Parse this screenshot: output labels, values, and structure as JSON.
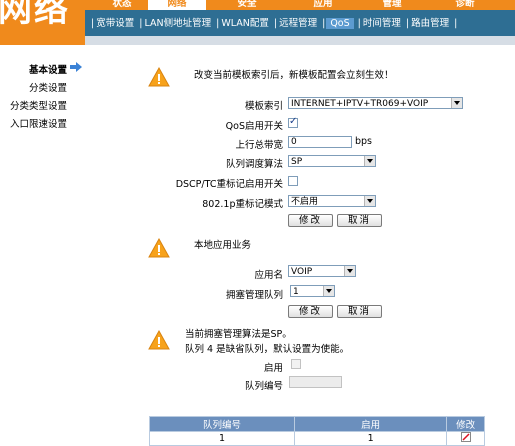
{
  "brand": {
    "text": "网络"
  },
  "main_tabs": [
    {
      "label": "状态"
    },
    {
      "label": "网络"
    },
    {
      "label": "安全"
    },
    {
      "label": "应用"
    },
    {
      "label": "管理"
    },
    {
      "label": "诊断"
    }
  ],
  "sub_nav": [
    {
      "label": "宽带设置"
    },
    {
      "label": "LAN侧地址管理"
    },
    {
      "label": "WLAN配置"
    },
    {
      "label": "远程管理"
    },
    {
      "label": "QoS"
    },
    {
      "label": "时间管理"
    },
    {
      "label": "路由管理"
    }
  ],
  "sidebar": {
    "items": [
      {
        "label": "基本设置"
      },
      {
        "label": "分类设置"
      },
      {
        "label": "分类类型设置"
      },
      {
        "label": "入口限速设置"
      }
    ]
  },
  "section1": {
    "warning": "改变当前模板索引后，新模板配置会立刻生效！",
    "template_label": "模板索引",
    "template_value": "INTERNET+IPTV+TR069+VOIP",
    "qos_enable_label": "QoS启用开关",
    "qos_enable_checked": true,
    "uplink_label": "上行总带宽",
    "uplink_value": "0",
    "uplink_unit": "bps",
    "queue_algo_label": "队列调度算法",
    "queue_algo_value": "SP",
    "dscp_label": "DSCP/TC重标记启用开关",
    "dscp_checked": false,
    "dot1p_label": "802.1p重标记模式",
    "dot1p_value": "不启用",
    "modify": "修改",
    "cancel": "取消"
  },
  "section2": {
    "title": "本地应用业务",
    "app_label": "应用名",
    "app_value": "VOIP",
    "queue_label": "拥塞管理队列",
    "queue_value": "1",
    "modify": "修改",
    "cancel": "取消"
  },
  "section3": {
    "line1": "当前拥塞管理算法是SP。",
    "line2": "队列 4 是缺省队列，默认设置为使能。",
    "enable_label": "启用",
    "queue_no_label": "队列编号"
  },
  "table": {
    "headers": [
      "队列编号",
      "启用",
      "修改"
    ],
    "rows": [
      [
        "1",
        "1"
      ]
    ]
  },
  "colors": {
    "accent_orange": "#f08a1c",
    "nav_blue": "#2e6e93",
    "table_header": "#6b8fbd"
  }
}
